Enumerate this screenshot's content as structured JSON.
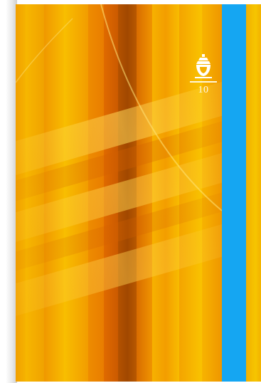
{
  "cover": {
    "page_number": "10",
    "accent_colors": {
      "background": "#f4a300",
      "stripe": "#15a6f2",
      "emblem": "#ffffff"
    },
    "emblem_icon": "crown-bell-icon"
  }
}
